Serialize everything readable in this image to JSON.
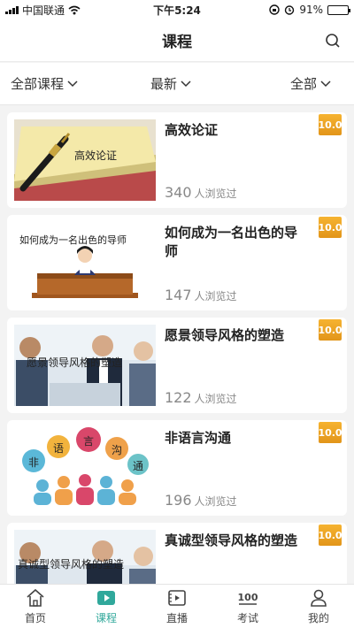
{
  "status": {
    "carrier": "中国联通",
    "time": "下午5:24",
    "battery": "91%",
    "battery_level": 0.91
  },
  "header": {
    "title": "课程"
  },
  "filters": [
    {
      "label": "全部课程"
    },
    {
      "label": "最新"
    },
    {
      "label": "全部"
    }
  ],
  "courses": [
    {
      "title": "高效论证",
      "views": "340",
      "views_label": "人浏览过",
      "score": "10.0",
      "thumb_text": "高效论证"
    },
    {
      "title": "如何成为一名出色的导师",
      "views": "147",
      "views_label": "人浏览过",
      "score": "10.0",
      "thumb_text": "如何成为一名出色的导师"
    },
    {
      "title": "愿景领导风格的塑造",
      "views": "122",
      "views_label": "人浏览过",
      "score": "10.0",
      "thumb_text": "愿景领导风格的塑造"
    },
    {
      "title": "非语言沟通",
      "views": "196",
      "views_label": "人浏览过",
      "score": "10.0",
      "thumb_text": [
        "非",
        "语",
        "言",
        "沟",
        "通"
      ]
    },
    {
      "title": "真诚型领导风格的塑造",
      "views": "",
      "views_label": "",
      "score": "10.0",
      "thumb_text": "真诚型领导风格的塑造"
    }
  ],
  "tabs": [
    {
      "label": "首页",
      "icon": "home-icon"
    },
    {
      "label": "课程",
      "icon": "play-icon",
      "active": true
    },
    {
      "label": "直播",
      "icon": "live-icon"
    },
    {
      "label": "考试",
      "icon": "exam-100-icon",
      "icon_text": "100"
    },
    {
      "label": "我的",
      "icon": "profile-icon"
    }
  ],
  "colors": {
    "accent": "#30a89b",
    "badge": "#eea527"
  }
}
